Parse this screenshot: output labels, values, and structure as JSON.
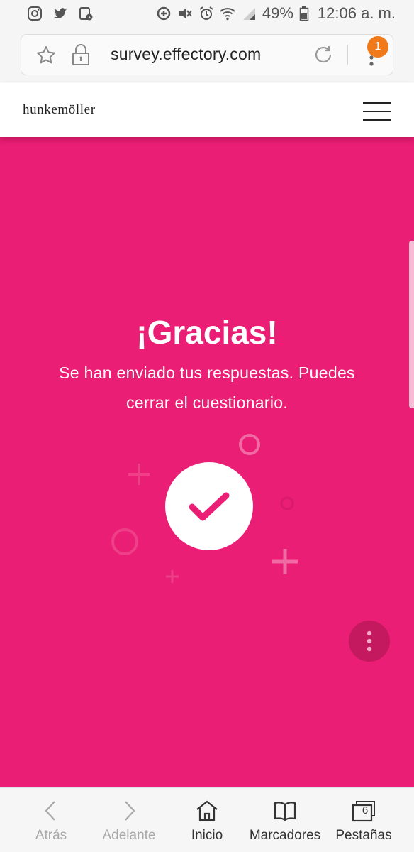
{
  "status_bar": {
    "battery": "49%",
    "time": "12:06 a. m."
  },
  "browser": {
    "url": "survey.effectory.com",
    "notification_count": "1"
  },
  "site": {
    "brand": "hunkemöller"
  },
  "content": {
    "title": "¡Gracias!",
    "message_line1": "Se han enviado tus respuestas. Puedes",
    "message_line2": "cerrar el cuestionario."
  },
  "bottom_nav": {
    "back": "Atrás",
    "forward": "Adelante",
    "home": "Inicio",
    "bookmarks": "Marcadores",
    "tabs": "Pestañas",
    "tabs_count": "6"
  },
  "colors": {
    "accent_pink": "#e91e74",
    "badge_orange": "#f07a1a"
  },
  "icons": [
    "instagram-icon",
    "twitter-icon",
    "calendar-icon",
    "data-saver-icon",
    "mute-icon",
    "alarm-icon",
    "wifi-icon",
    "signal-icon",
    "battery-icon",
    "star-icon",
    "lock-icon",
    "reload-icon",
    "menu-dots-icon",
    "hamburger-icon",
    "checkmark-icon",
    "back-icon",
    "forward-icon",
    "home-icon",
    "bookmarks-icon",
    "tabs-icon"
  ]
}
